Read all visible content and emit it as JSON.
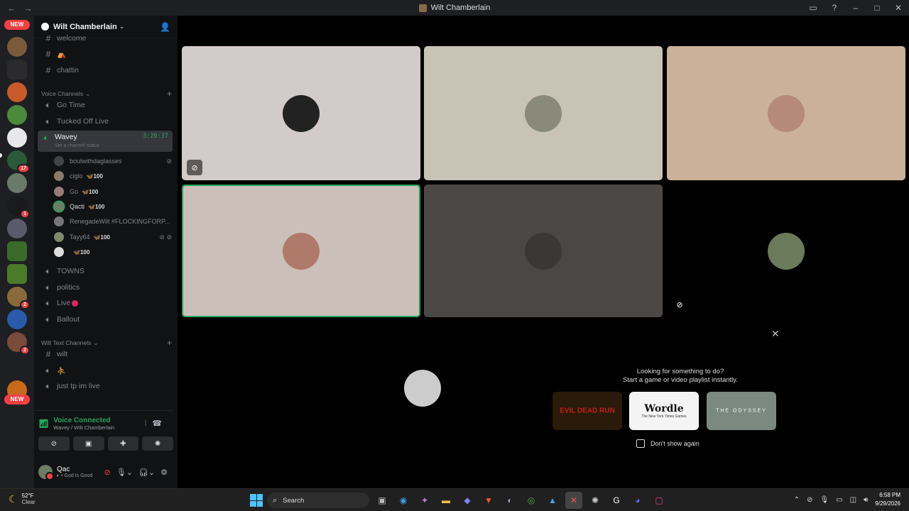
{
  "window": {
    "title": "Wilt Chamberlain"
  },
  "servers": {
    "new_label": "NEW",
    "badges": [
      "17",
      "1",
      "2",
      "2"
    ]
  },
  "guild": {
    "name": "Wilt Chamberlain"
  },
  "channels": {
    "top": [
      {
        "name": "welcome",
        "type": "text"
      },
      {
        "name": "⛺",
        "type": "text"
      },
      {
        "name": "chattin",
        "type": "text"
      }
    ],
    "voice_category": "Voice Channels",
    "voice": [
      {
        "name": "Go Time"
      },
      {
        "name": "Tucked Off Live"
      },
      {
        "name": "Wavey",
        "timer": "3:20:37",
        "status": "Set a channel status"
      },
      {
        "name": "TOWNS"
      },
      {
        "name": "politics"
      },
      {
        "name": "Live"
      },
      {
        "name": "Ballout"
      }
    ],
    "members": [
      {
        "name": "boulwithdaglasses",
        "tag": ""
      },
      {
        "name": "ciglo",
        "tag": "🦋100"
      },
      {
        "name": "Go",
        "tag": "🦋100"
      },
      {
        "name": "Qacti",
        "tag": "🦋100"
      },
      {
        "name": "RenegadeWilt #FLOCKINGFORP...",
        "tag": ""
      },
      {
        "name": "Tayy64",
        "tag": "🦋100"
      },
      {
        "name": "",
        "tag": "🦋100"
      }
    ],
    "text_category": "Wilt Text Channels",
    "text": [
      {
        "name": "wilt",
        "type": "text"
      },
      {
        "name": "⛹",
        "type": "voice"
      },
      {
        "name": "just tp im live",
        "type": "voice"
      }
    ]
  },
  "voice_status": {
    "connected": "Voice Connected",
    "location": "Wavey / Wilt Chamberlain"
  },
  "user": {
    "name": "Qac",
    "status": "God Is Good"
  },
  "activity": {
    "line1": "Looking for something to do?",
    "line2": "Start a game or video playlist instantly.",
    "cards": [
      "EVIL DEAD RUN",
      "Wordle",
      "THE ODYSSEY"
    ],
    "wordle_sub": "The New York Times Games",
    "dont_show": "Don't show again"
  },
  "taskbar": {
    "temp": "52°F",
    "condition": "Clear",
    "search": "Search",
    "time": "6:58 PM",
    "date": "9/29/2026"
  },
  "colors": {
    "accent_green": "#23a559",
    "danger": "#f23f43",
    "blurple": "#5865f2"
  }
}
